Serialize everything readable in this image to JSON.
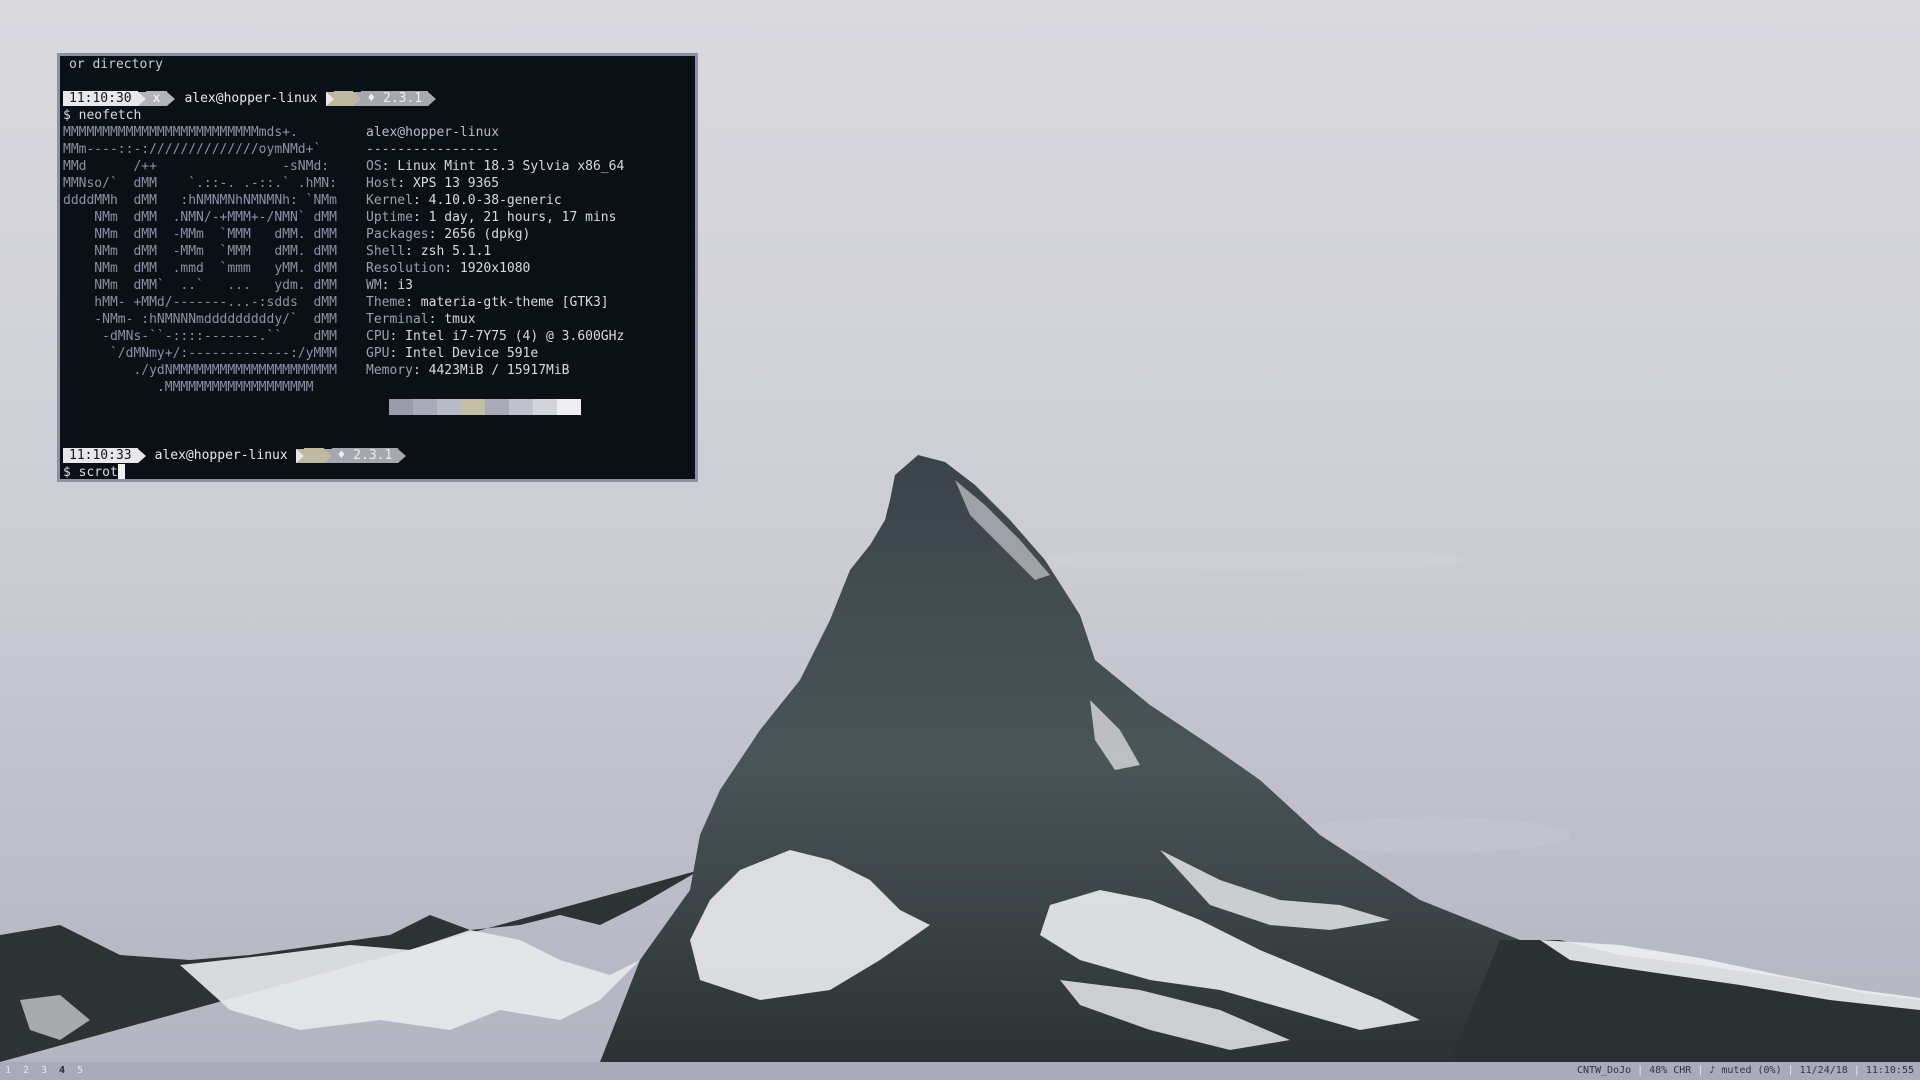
{
  "terminal": {
    "top_line": "or directory",
    "prompts": [
      {
        "time": "11:10:30",
        "status": "x",
        "user_host": "alex@hopper-linux",
        "dir": "~",
        "git": "♦ 2.3.1",
        "command": "$ neofetch"
      },
      {
        "time": "11:10:33",
        "user_host": "alex@hopper-linux",
        "dir": "~",
        "git": "♦ 2.3.1",
        "command": "$ scrot"
      }
    ],
    "ascii_art": [
      "MMMMMMMMMMMMMMMMMMMMMMMMMmds+.",
      "MMm----::-://////////////oymNMd+`",
      "MMd      /++                -sNMd:",
      "MMNso/`  dMM    `.::-. .-::.` .hMN:",
      "ddddMMh  dMM   :hNMNMNhNMNMNh: `NMm",
      "    NMm  dMM  .NMN/-+MMM+-/NMN` dMM",
      "    NMm  dMM  -MMm  `MMM   dMM. dMM",
      "    NMm  dMM  -MMm  `MMM   dMM. dMM",
      "    NMm  dMM  .mmd  `mmm   yMM. dMM",
      "    NMm  dMM`  ..`   ...   ydm. dMM",
      "    hMM- +MMd/-------...-:sdds  dMM",
      "    -NMm- :hNMNNNmdddddddddy/`  dMM",
      "     -dMNs-``-::::-------.``    dMM",
      "      `/dMNmy+/:-------------:/yMMM",
      "         ./ydNMMMMMMMMMMMMMMMMMMMMM",
      "            .MMMMMMMMMMMMMMMMMMM"
    ],
    "info_title": "alex@hopper-linux",
    "info_rule": "-----------------",
    "info": [
      {
        "key": "OS",
        "value": "Linux Mint 18.3 Sylvia x86_64"
      },
      {
        "key": "Host",
        "value": "XPS 13 9365"
      },
      {
        "key": "Kernel",
        "value": "4.10.0-38-generic"
      },
      {
        "key": "Uptime",
        "value": "1 day, 21 hours, 17 mins"
      },
      {
        "key": "Packages",
        "value": "2656 (dpkg)"
      },
      {
        "key": "Shell",
        "value": "zsh 5.1.1"
      },
      {
        "key": "Resolution",
        "value": "1920x1080"
      },
      {
        "key": "WM",
        "value": "i3"
      },
      {
        "key": "Theme",
        "value": "materia-gtk-theme [GTK3]"
      },
      {
        "key": "Terminal",
        "value": "tmux"
      },
      {
        "key": "CPU",
        "value": "Intel i7-7Y75 (4) @ 3.600GHz"
      },
      {
        "key": "GPU",
        "value": "Intel Device 591e"
      },
      {
        "key": "Memory",
        "value": "4423MiB / 15917MiB"
      }
    ],
    "palette": [
      "#9a9cab",
      "#a9abba",
      "#b8bac7",
      "#c4bea5",
      "#a9aab8",
      "#bfc1cc",
      "#d3d4dc",
      "#eeeef2"
    ]
  },
  "bar": {
    "workspaces": [
      "1",
      "2",
      "3",
      "4",
      "5"
    ],
    "active_workspace": "4",
    "status": [
      "CNTW_DoJo",
      "48% CHR",
      "♪ muted (0%)",
      "11/24/18",
      "11:10:55"
    ]
  }
}
